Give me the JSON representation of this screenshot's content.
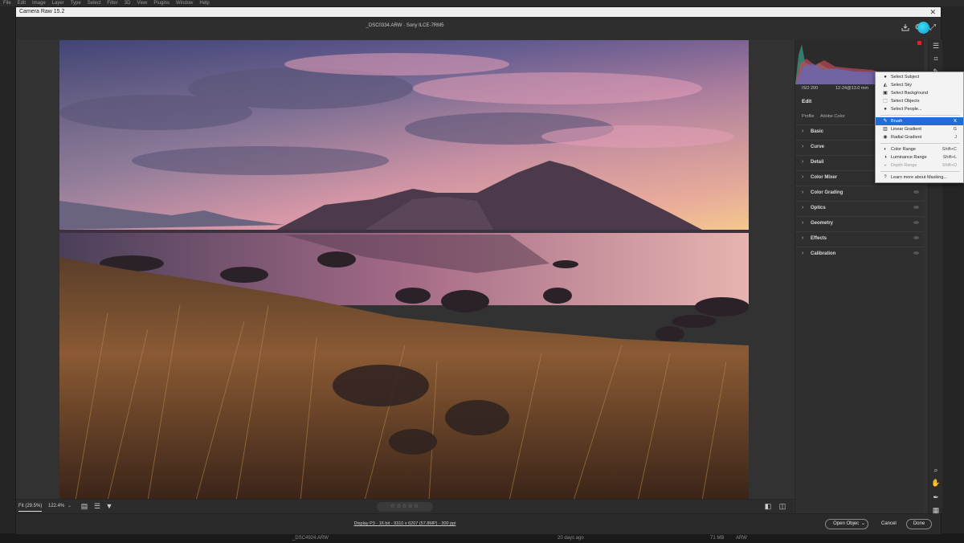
{
  "ps_menu": [
    "File",
    "Edit",
    "Image",
    "Layer",
    "Type",
    "Select",
    "Filter",
    "3D",
    "View",
    "Plugins",
    "Window",
    "Help"
  ],
  "window": {
    "title": "Camera Raw 15.2",
    "close": "✕"
  },
  "header": {
    "file_title": "_DSC0334.ARW  ·  Sony ILCE-7RM5"
  },
  "camera_info": {
    "iso": "ISO 200",
    "lens": "12-24@13.0 mm"
  },
  "panel": {
    "edit_title": "Edit",
    "profile_label": "Profile",
    "profile_value": "Adobe Color",
    "sections": [
      "Basic",
      "Curve",
      "Detail",
      "Color Mixer",
      "Color Grading",
      "Optics",
      "Geometry",
      "Effects",
      "Calibration"
    ]
  },
  "mask_menu": {
    "items": [
      {
        "label": "Select Subject",
        "icon": "subject-icon",
        "shortcut": ""
      },
      {
        "label": "Select Sky",
        "icon": "sky-icon",
        "shortcut": ""
      },
      {
        "label": "Select Background",
        "icon": "background-icon",
        "shortcut": ""
      },
      {
        "label": "Select Objects",
        "icon": "objects-icon",
        "shortcut": ""
      },
      {
        "label": "Select People...",
        "icon": "people-icon",
        "shortcut": ""
      },
      {
        "label": "Brush",
        "icon": "brush-icon",
        "shortcut": "K"
      },
      {
        "label": "Linear Gradient",
        "icon": "linear-gradient-icon",
        "shortcut": "G"
      },
      {
        "label": "Radial Gradient",
        "icon": "radial-gradient-icon",
        "shortcut": "J"
      },
      {
        "label": "Color Range",
        "icon": "color-range-icon",
        "shortcut": "Shift+C"
      },
      {
        "label": "Luminance Range",
        "icon": "luminance-range-icon",
        "shortcut": "Shift+L"
      },
      {
        "label": "Depth Range",
        "icon": "depth-range-icon",
        "shortcut": "Shift+D"
      },
      {
        "label": "Learn more about Masking...",
        "icon": "help-icon",
        "shortcut": ""
      }
    ],
    "selected": "Brush",
    "disabled": "Depth Range"
  },
  "bottom_bar": {
    "zoom_fit": "Fit (29.5%)",
    "zoom_pct": "122.4%",
    "rating": "☆☆☆☆☆"
  },
  "footer": {
    "info": "Display P3 - 16 bit - 9310 x 6207 (57.8MP) - 300 ppi",
    "open_object": "Open Object",
    "cancel": "Cancel",
    "done": "Done"
  },
  "ps_status": {
    "filename": "_DSC4924.ARW",
    "date": "20 days ago",
    "size": "71 MB",
    "type": "ARW"
  },
  "colors": {
    "accent": "#1d6fd8",
    "avatar": "#12b7e0",
    "clip_warning": "#e0222a"
  }
}
